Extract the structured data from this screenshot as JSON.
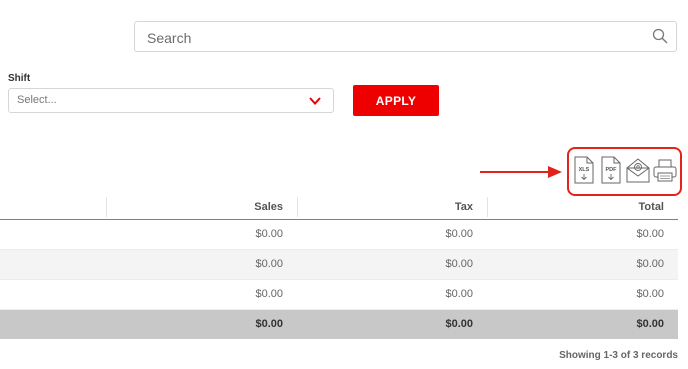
{
  "search": {
    "placeholder": "Search",
    "icon": "search-icon"
  },
  "filter": {
    "shift_label": "Shift",
    "shift_selected": "Select...",
    "chevron_color": "#ee0000",
    "apply_label": "APPLY"
  },
  "export": {
    "icons": [
      "xls-file-icon",
      "pdf-file-icon",
      "email-icon",
      "print-icon"
    ],
    "xls_text": "XLS",
    "pdf_text": "PDF",
    "highlight_color": "#e2231a"
  },
  "table": {
    "headers": {
      "sales": "Sales",
      "tax": "Tax",
      "total": "Total"
    },
    "rows": [
      {
        "sales": "$0.00",
        "tax": "$0.00",
        "total": "$0.00"
      },
      {
        "sales": "$0.00",
        "tax": "$0.00",
        "total": "$0.00"
      },
      {
        "sales": "$0.00",
        "tax": "$0.00",
        "total": "$0.00"
      }
    ],
    "totals": {
      "sales": "$0.00",
      "tax": "$0.00",
      "total": "$0.00"
    }
  },
  "pagination": {
    "summary": "Showing 1-3 of 3 records"
  },
  "colors": {
    "accent": "#ee0000",
    "total_row_bg": "#c8c8c8"
  }
}
